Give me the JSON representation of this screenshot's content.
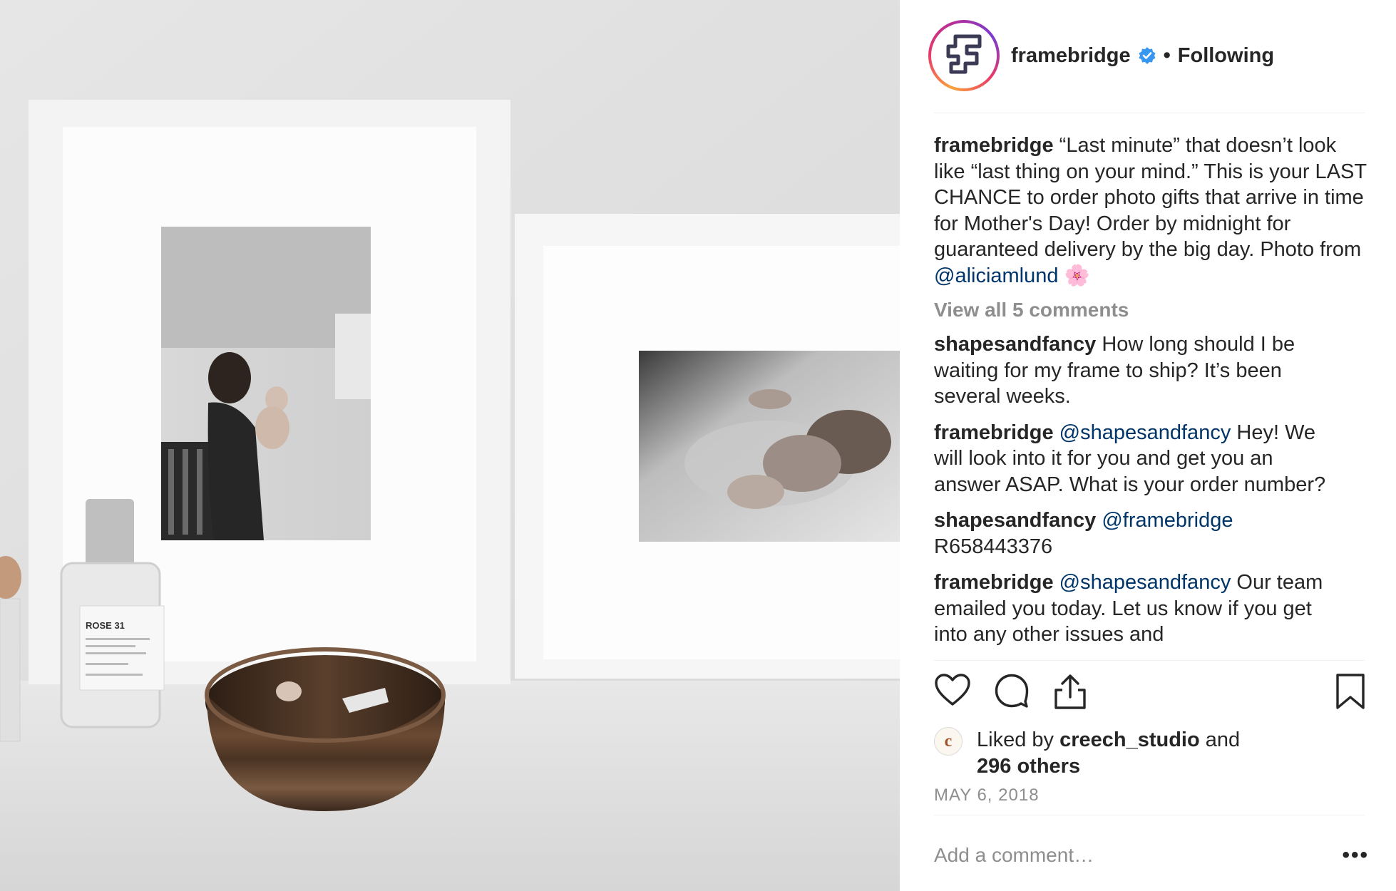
{
  "post": {
    "username": "framebridge",
    "follow_status": "Following",
    "separator": "•"
  },
  "caption": {
    "username": "framebridge",
    "text_part1": " “Last minute” that doesn’t look like “last thing on your mind.” This is your LAST CHANCE to order photo gifts that arrive in time for Mother's Day! Order by midnight for guaranteed delivery by the big day. Photo from ",
    "mention": "@aliciamlund",
    "emoji": "🌸"
  },
  "view_all_comments": "View all 5 comments",
  "comments": [
    {
      "user": "shapesandfancy",
      "mention": "",
      "text": " How long should I be waiting for my frame to ship? It’s been several weeks."
    },
    {
      "user": "framebridge",
      "mention": " @shapesandfancy",
      "text": " Hey! We will look into it for you and get you an answer ASAP. What is your order number?"
    },
    {
      "user": "shapesandfancy",
      "mention": " @framebridge",
      "text": " R658443376"
    },
    {
      "user": "framebridge",
      "mention": " @shapesandfancy",
      "text": " Our team emailed you today. Let us know if you get into any other issues and"
    }
  ],
  "likes": {
    "prefix": "Liked by ",
    "user": "creech_studio",
    "middle": " and",
    "others": "296 others",
    "avatar_letter": "c"
  },
  "date": "MAY 6, 2018",
  "add_comment_placeholder": "Add a comment…",
  "more_label": "•••",
  "photo": {
    "bottle_label": "ROSE 31"
  },
  "icons": {
    "heart": "heart-icon",
    "comment": "comment-icon",
    "share": "share-icon",
    "bookmark": "bookmark-icon",
    "verified": "verified-badge-icon"
  },
  "colors": {
    "mention": "#003569",
    "muted": "#8e8e8e",
    "text": "#262626",
    "verified": "#3897f0"
  }
}
